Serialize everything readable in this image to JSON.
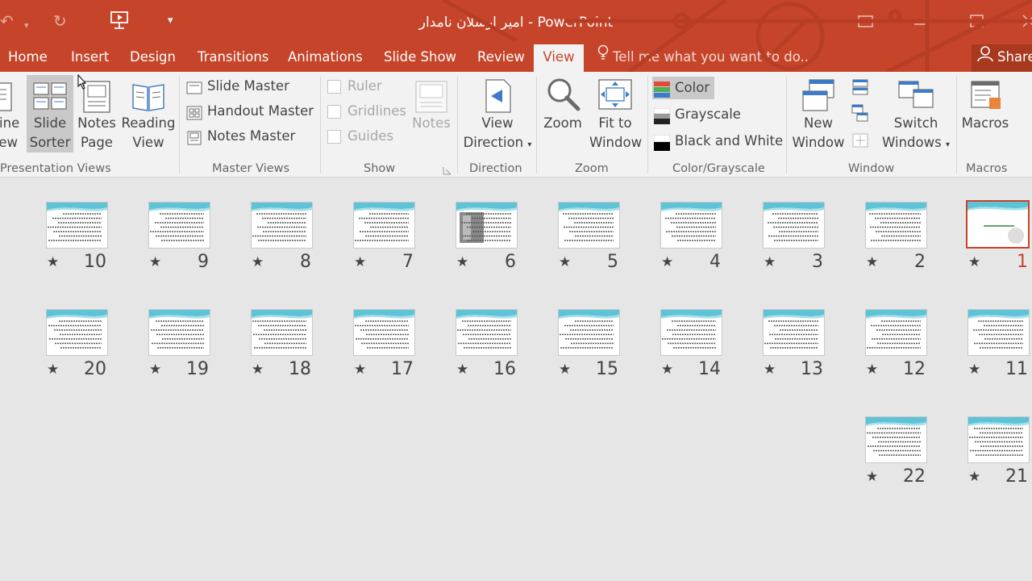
{
  "app": {
    "title": "امیر ارسلان نامدار - PowerPoint",
    "accent": "#c6452a"
  },
  "tabs": [
    "Home",
    "Insert",
    "Design",
    "Transitions",
    "Animations",
    "Slide Show",
    "Review",
    "View"
  ],
  "active_tab": "View",
  "tellme": "Tell me what you want to do...",
  "share": "Share",
  "ribbon": {
    "presentation_views": {
      "label": "Presentation Views",
      "outline_l1": "tline",
      "outline_l2": "ew",
      "slide_sorter_l1": "Slide",
      "slide_sorter_l2": "Sorter",
      "notes_page_l1": "Notes",
      "notes_page_l2": "Page",
      "reading_view_l1": "Reading",
      "reading_view_l2": "View"
    },
    "master_views": {
      "label": "Master Views",
      "slide_master": "Slide Master",
      "handout_master": "Handout Master",
      "notes_master": "Notes Master"
    },
    "show": {
      "label": "Show",
      "ruler": "Ruler",
      "gridlines": "Gridlines",
      "guides": "Guides",
      "notes": "Notes"
    },
    "direction": {
      "label": "Direction",
      "view_direction_l1": "View",
      "view_direction_l2": "Direction"
    },
    "zoom": {
      "label": "Zoom",
      "zoom": "Zoom",
      "fit_l1": "Fit to",
      "fit_l2": "Window"
    },
    "color": {
      "label": "Color/Grayscale",
      "color": "Color",
      "grayscale": "Grayscale",
      "bw": "Black and White"
    },
    "window": {
      "label": "Window",
      "new_l1": "New",
      "new_l2": "Window",
      "switch_l1": "Switch",
      "switch_l2": "Windows"
    },
    "macros": {
      "label": "Macros",
      "macros": "Macros"
    }
  },
  "slides": {
    "star": "★",
    "row1": [
      "10",
      "9",
      "8",
      "7",
      "6",
      "5",
      "4",
      "3",
      "2",
      "1"
    ],
    "row2": [
      "20",
      "19",
      "18",
      "17",
      "16",
      "15",
      "14",
      "13",
      "12",
      "11"
    ],
    "row3": [
      "22",
      "21"
    ],
    "selected": "1"
  }
}
